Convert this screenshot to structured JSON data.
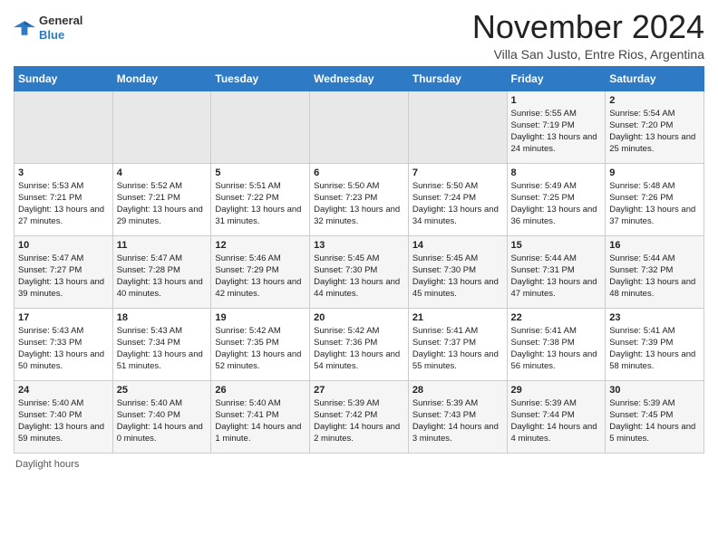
{
  "header": {
    "logo_line1": "General",
    "logo_line2": "Blue",
    "month_title": "November 2024",
    "location": "Villa San Justo, Entre Rios, Argentina"
  },
  "footer": {
    "daylight_label": "Daylight hours"
  },
  "weekdays": [
    "Sunday",
    "Monday",
    "Tuesday",
    "Wednesday",
    "Thursday",
    "Friday",
    "Saturday"
  ],
  "weeks": [
    [
      {
        "day": "",
        "empty": true
      },
      {
        "day": "",
        "empty": true
      },
      {
        "day": "",
        "empty": true
      },
      {
        "day": "",
        "empty": true
      },
      {
        "day": "",
        "empty": true
      },
      {
        "day": "1",
        "sunrise": "Sunrise: 5:55 AM",
        "sunset": "Sunset: 7:19 PM",
        "daylight": "Daylight: 13 hours and 24 minutes."
      },
      {
        "day": "2",
        "sunrise": "Sunrise: 5:54 AM",
        "sunset": "Sunset: 7:20 PM",
        "daylight": "Daylight: 13 hours and 25 minutes."
      }
    ],
    [
      {
        "day": "3",
        "sunrise": "Sunrise: 5:53 AM",
        "sunset": "Sunset: 7:21 PM",
        "daylight": "Daylight: 13 hours and 27 minutes."
      },
      {
        "day": "4",
        "sunrise": "Sunrise: 5:52 AM",
        "sunset": "Sunset: 7:21 PM",
        "daylight": "Daylight: 13 hours and 29 minutes."
      },
      {
        "day": "5",
        "sunrise": "Sunrise: 5:51 AM",
        "sunset": "Sunset: 7:22 PM",
        "daylight": "Daylight: 13 hours and 31 minutes."
      },
      {
        "day": "6",
        "sunrise": "Sunrise: 5:50 AM",
        "sunset": "Sunset: 7:23 PM",
        "daylight": "Daylight: 13 hours and 32 minutes."
      },
      {
        "day": "7",
        "sunrise": "Sunrise: 5:50 AM",
        "sunset": "Sunset: 7:24 PM",
        "daylight": "Daylight: 13 hours and 34 minutes."
      },
      {
        "day": "8",
        "sunrise": "Sunrise: 5:49 AM",
        "sunset": "Sunset: 7:25 PM",
        "daylight": "Daylight: 13 hours and 36 minutes."
      },
      {
        "day": "9",
        "sunrise": "Sunrise: 5:48 AM",
        "sunset": "Sunset: 7:26 PM",
        "daylight": "Daylight: 13 hours and 37 minutes."
      }
    ],
    [
      {
        "day": "10",
        "sunrise": "Sunrise: 5:47 AM",
        "sunset": "Sunset: 7:27 PM",
        "daylight": "Daylight: 13 hours and 39 minutes."
      },
      {
        "day": "11",
        "sunrise": "Sunrise: 5:47 AM",
        "sunset": "Sunset: 7:28 PM",
        "daylight": "Daylight: 13 hours and 40 minutes."
      },
      {
        "day": "12",
        "sunrise": "Sunrise: 5:46 AM",
        "sunset": "Sunset: 7:29 PM",
        "daylight": "Daylight: 13 hours and 42 minutes."
      },
      {
        "day": "13",
        "sunrise": "Sunrise: 5:45 AM",
        "sunset": "Sunset: 7:30 PM",
        "daylight": "Daylight: 13 hours and 44 minutes."
      },
      {
        "day": "14",
        "sunrise": "Sunrise: 5:45 AM",
        "sunset": "Sunset: 7:30 PM",
        "daylight": "Daylight: 13 hours and 45 minutes."
      },
      {
        "day": "15",
        "sunrise": "Sunrise: 5:44 AM",
        "sunset": "Sunset: 7:31 PM",
        "daylight": "Daylight: 13 hours and 47 minutes."
      },
      {
        "day": "16",
        "sunrise": "Sunrise: 5:44 AM",
        "sunset": "Sunset: 7:32 PM",
        "daylight": "Daylight: 13 hours and 48 minutes."
      }
    ],
    [
      {
        "day": "17",
        "sunrise": "Sunrise: 5:43 AM",
        "sunset": "Sunset: 7:33 PM",
        "daylight": "Daylight: 13 hours and 50 minutes."
      },
      {
        "day": "18",
        "sunrise": "Sunrise: 5:43 AM",
        "sunset": "Sunset: 7:34 PM",
        "daylight": "Daylight: 13 hours and 51 minutes."
      },
      {
        "day": "19",
        "sunrise": "Sunrise: 5:42 AM",
        "sunset": "Sunset: 7:35 PM",
        "daylight": "Daylight: 13 hours and 52 minutes."
      },
      {
        "day": "20",
        "sunrise": "Sunrise: 5:42 AM",
        "sunset": "Sunset: 7:36 PM",
        "daylight": "Daylight: 13 hours and 54 minutes."
      },
      {
        "day": "21",
        "sunrise": "Sunrise: 5:41 AM",
        "sunset": "Sunset: 7:37 PM",
        "daylight": "Daylight: 13 hours and 55 minutes."
      },
      {
        "day": "22",
        "sunrise": "Sunrise: 5:41 AM",
        "sunset": "Sunset: 7:38 PM",
        "daylight": "Daylight: 13 hours and 56 minutes."
      },
      {
        "day": "23",
        "sunrise": "Sunrise: 5:41 AM",
        "sunset": "Sunset: 7:39 PM",
        "daylight": "Daylight: 13 hours and 58 minutes."
      }
    ],
    [
      {
        "day": "24",
        "sunrise": "Sunrise: 5:40 AM",
        "sunset": "Sunset: 7:40 PM",
        "daylight": "Daylight: 13 hours and 59 minutes."
      },
      {
        "day": "25",
        "sunrise": "Sunrise: 5:40 AM",
        "sunset": "Sunset: 7:40 PM",
        "daylight": "Daylight: 14 hours and 0 minutes."
      },
      {
        "day": "26",
        "sunrise": "Sunrise: 5:40 AM",
        "sunset": "Sunset: 7:41 PM",
        "daylight": "Daylight: 14 hours and 1 minute."
      },
      {
        "day": "27",
        "sunrise": "Sunrise: 5:39 AM",
        "sunset": "Sunset: 7:42 PM",
        "daylight": "Daylight: 14 hours and 2 minutes."
      },
      {
        "day": "28",
        "sunrise": "Sunrise: 5:39 AM",
        "sunset": "Sunset: 7:43 PM",
        "daylight": "Daylight: 14 hours and 3 minutes."
      },
      {
        "day": "29",
        "sunrise": "Sunrise: 5:39 AM",
        "sunset": "Sunset: 7:44 PM",
        "daylight": "Daylight: 14 hours and 4 minutes."
      },
      {
        "day": "30",
        "sunrise": "Sunrise: 5:39 AM",
        "sunset": "Sunset: 7:45 PM",
        "daylight": "Daylight: 14 hours and 5 minutes."
      }
    ]
  ]
}
